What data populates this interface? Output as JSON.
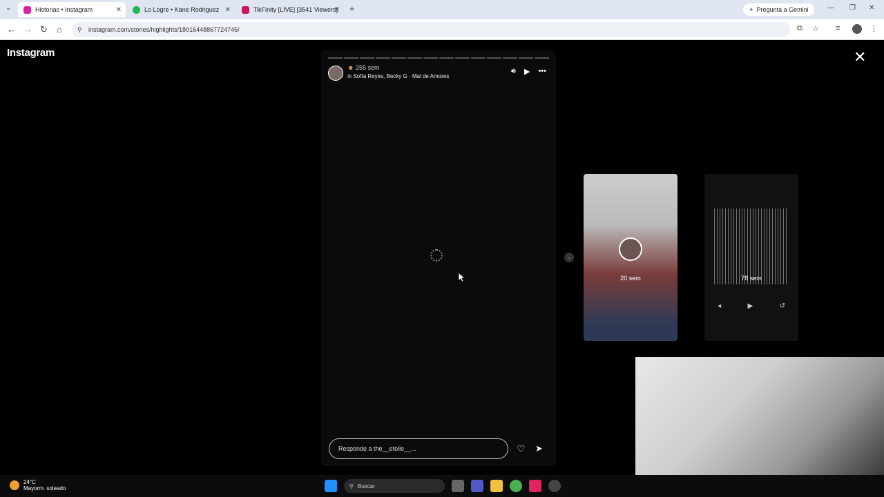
{
  "browser": {
    "tabs": [
      {
        "label": "Historias • Instagram",
        "color": "#d6249f",
        "active": true
      },
      {
        "label": "Lo Logre • Kane Rodriguez",
        "color": "#1db954",
        "active": false
      },
      {
        "label": "TikFinity [LIVE] [3541 Viewers]",
        "color": "#c2185b",
        "active": false
      }
    ],
    "gemini_label": "Pregunta a Gemini",
    "url": "instagram.com/stories/highlights/18016448867724745/"
  },
  "instagram": {
    "logo": "Instagram",
    "story": {
      "time": "255 sem",
      "song": "Sofía Reyes, Becky G · Mal de Amores",
      "progress_segments": 14,
      "completed_segments": 0,
      "reply_placeholder": "Responde a the__etoile__..."
    },
    "next_stories": [
      {
        "time": "20 sem"
      },
      {
        "time": "78 sem"
      }
    ]
  },
  "taskbar": {
    "temperature": "24°C",
    "weather": "Mayorm. soleado",
    "search_placeholder": "Buscar"
  },
  "colors": {
    "accent": "#0095f6",
    "background": "#000000"
  }
}
